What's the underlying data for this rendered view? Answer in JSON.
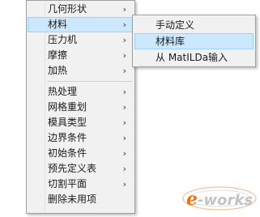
{
  "main_menu": {
    "items": [
      {
        "label": "几何形状",
        "arrow": "›"
      },
      {
        "label": "材料",
        "arrow": "›"
      },
      {
        "label": "压力机",
        "arrow": "›"
      },
      {
        "label": "摩擦",
        "arrow": "›"
      },
      {
        "label": "加热",
        "arrow": "›"
      },
      {
        "label": "热处理",
        "arrow": "›"
      },
      {
        "label": "网格重划",
        "arrow": "›"
      },
      {
        "label": "模具类型",
        "arrow": "›"
      },
      {
        "label": "边界条件",
        "arrow": "›"
      },
      {
        "label": "初始条件",
        "arrow": "›"
      },
      {
        "label": "预先定义表",
        "arrow": "›"
      },
      {
        "label": "切割平面",
        "arrow": "›"
      },
      {
        "label": "删除未用项",
        "arrow": ""
      }
    ]
  },
  "sub_menu": {
    "items": [
      {
        "label": "手动定义"
      },
      {
        "label": "材料库"
      },
      {
        "label": "从 MatILDa输入"
      }
    ]
  },
  "watermark": {
    "logo_text": "e-works",
    "icon": "eworks-logo-icon",
    "accent_color": "#e8731a"
  }
}
